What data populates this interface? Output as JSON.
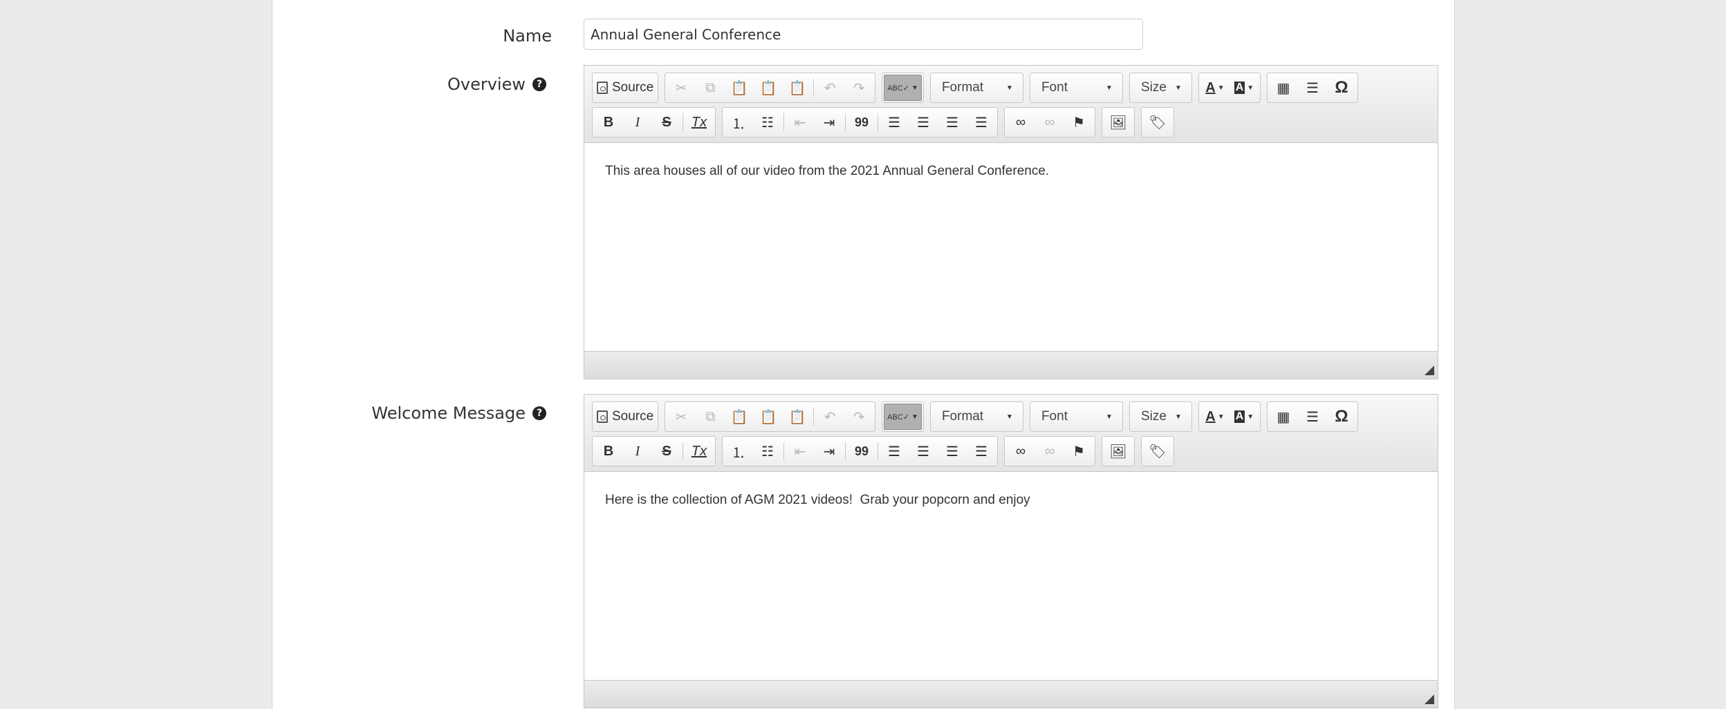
{
  "form": {
    "name_label": "Name",
    "name_value": "Annual General Conference",
    "overview_label": "Overview",
    "welcome_label": "Welcome Message",
    "help_glyph": "?"
  },
  "toolbar": {
    "source_label": "Source",
    "format_label": "Format",
    "font_label": "Font",
    "size_label": "Size",
    "spell_glyph": "ABC✓",
    "text_color_glyph": "A",
    "bg_color_glyph": "A",
    "special_char_glyph": "Ω",
    "bold_glyph": "B",
    "italic_glyph": "I",
    "strike_glyph": "S",
    "remove_format_glyph": "Tx",
    "blockquote_glyph": "99"
  },
  "editors": {
    "overview_content": "This area houses all of our video from the 2021 Annual General Conference.",
    "welcome_content": "Here is the collection of AGM 2021 videos!  Grab your popcorn and enjoy"
  },
  "icons": [
    "source-icon",
    "cut-icon",
    "copy-icon",
    "paste-icon",
    "paste-text-icon",
    "paste-word-icon",
    "undo-icon",
    "redo-icon",
    "spellcheck-icon",
    "text-color-icon",
    "bg-color-icon",
    "table-icon",
    "horizontal-rule-icon",
    "special-char-icon",
    "bold-icon",
    "italic-icon",
    "strike-icon",
    "remove-format-icon",
    "numbered-list-icon",
    "bulleted-list-icon",
    "outdent-icon",
    "indent-icon",
    "blockquote-icon",
    "align-left-icon",
    "align-center-icon",
    "align-right-icon",
    "justify-icon",
    "link-icon",
    "unlink-icon",
    "anchor-icon",
    "image-icon",
    "tag-icon",
    "resize-grip-icon"
  ],
  "colors": {
    "page_bg": "#ebebeb",
    "panel_bg": "#ffffff",
    "toolbar_top": "#f7f7f7",
    "toolbar_bottom": "#e4e4e4",
    "text": "#333333"
  }
}
